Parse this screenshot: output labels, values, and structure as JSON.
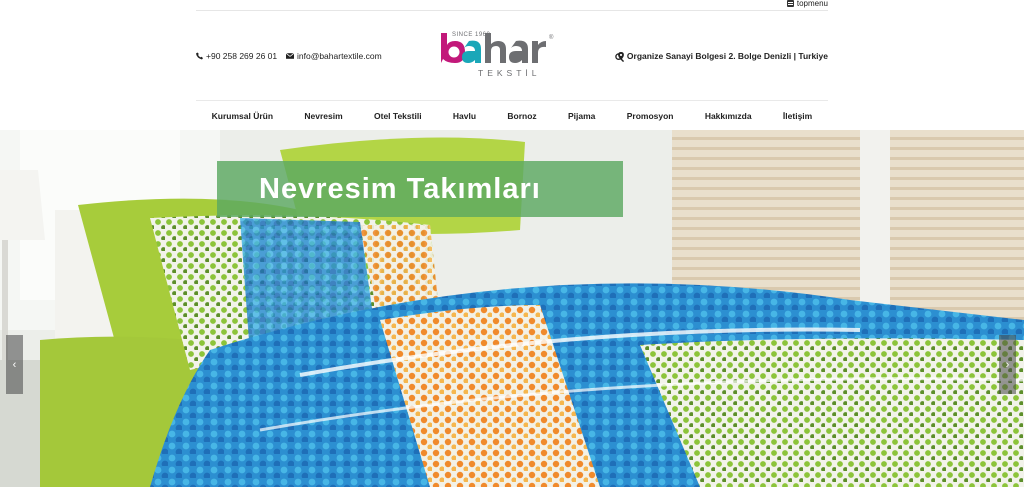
{
  "topbar": {
    "topmenu_label": "topmenu"
  },
  "header": {
    "phone": "+90 258 269 26 01",
    "email": "info@bahartextile.com",
    "address": "Organize Sanayi Bolgesi 2. Bolge Denizli | Turkiye",
    "logo": {
      "since": "SINCE 1960",
      "brand": "bahar",
      "sub": "TEKSTİL",
      "registered": "®"
    }
  },
  "nav": {
    "items": [
      "Kurumsal Ürün",
      "Nevresim",
      "Otel Tekstili",
      "Havlu",
      "Bornoz",
      "Pijama",
      "Promosyon",
      "Hakkımızda",
      "İletişim"
    ]
  },
  "hero": {
    "caption": "Nevresim Takımları",
    "prev_label": "‹",
    "next_label": "›"
  },
  "colors": {
    "caption_bg": "#5ca862",
    "logo_magenta": "#c2187a",
    "logo_teal": "#1aa7b8",
    "logo_gray": "#6d6e71"
  }
}
